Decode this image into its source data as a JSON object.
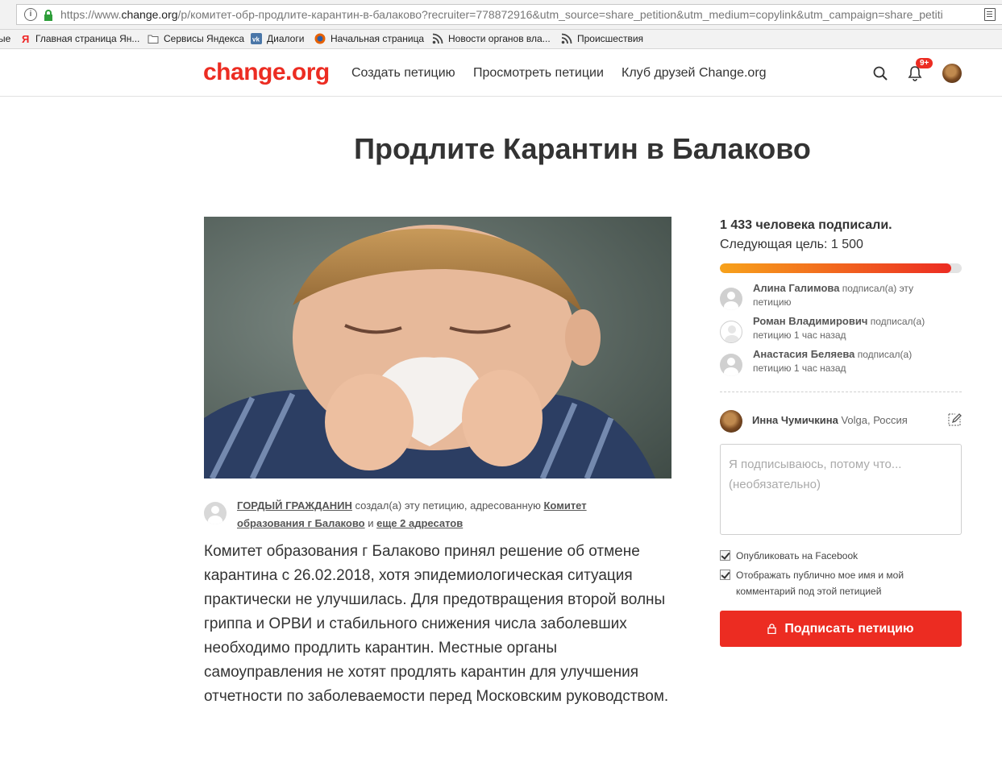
{
  "browser": {
    "url_prefix": "https://www.",
    "url_domain": "change.org",
    "url_rest": "/p/комитет-обр-продлите-карантин-в-балаково?recruiter=778872916&utm_source=share_petition&utm_medium=copylink&utm_campaign=share_petiti",
    "bookmarks": [
      {
        "label": "ые"
      },
      {
        "label": "Главная страница Ян..."
      },
      {
        "label": "Сервисы Яндекса"
      },
      {
        "label": "Диалоги"
      },
      {
        "label": "Начальная страница"
      },
      {
        "label": "Новости органов вла..."
      },
      {
        "label": "Происшествия"
      }
    ]
  },
  "header": {
    "logo": "change.org",
    "nav": [
      "Создать петицию",
      "Просмотреть петиции",
      "Клуб друзей Change.org"
    ],
    "notification_badge": "9+"
  },
  "petition": {
    "title": "Продлите Карантин в Балаково",
    "creator_name": "ГОРДЫЙ ГРАЖДАНИН",
    "created_text": " создал(а) эту петицию, адресованную ",
    "target_name": "Комитет образования г Балаково",
    "and_text": " и ",
    "more_targets": "еще 2 адресатов",
    "description": "Комитет образования г Балаково принял решение об отмене карантина с 26.02.2018, хотя эпидемиологическая ситуация практически не улучшилась. Для предотвращения второй волны гриппа и ОРВИ и стабильного снижения числа заболевших необходимо продлить карантин. Местные органы самоуправления не хотят продлять карантин для улучшения отчетности по заболеваемости перед Московским руководством."
  },
  "signatures": {
    "count_text": "1 433 человека подписали.",
    "goal_text": "Следующая цель: 1 500",
    "progress_fraction": 0.955,
    "recent": [
      {
        "name": "Алина Галимова",
        "action": " подписал(а) эту петицию"
      },
      {
        "name": "Роман Владимирович",
        "action": " подписал(а) петицию 1 час назад"
      },
      {
        "name": "Анастасия Беляева",
        "action": " подписал(а) петицию 1 час назад"
      }
    ]
  },
  "sign_form": {
    "user_name": "Инна Чумичкина",
    "user_location": " Volga, Россия",
    "reason_placeholder": "Я подписываюсь, потому что... (необязательно)",
    "checkbox_facebook": "Опубликовать на Facebook",
    "checkbox_public": "Отображать публично мое имя и мой комментарий под этой петицией",
    "sign_button": "Подписать петицию"
  },
  "colors": {
    "brand": "#ec2c22",
    "progress_start": "#f7a21b"
  }
}
